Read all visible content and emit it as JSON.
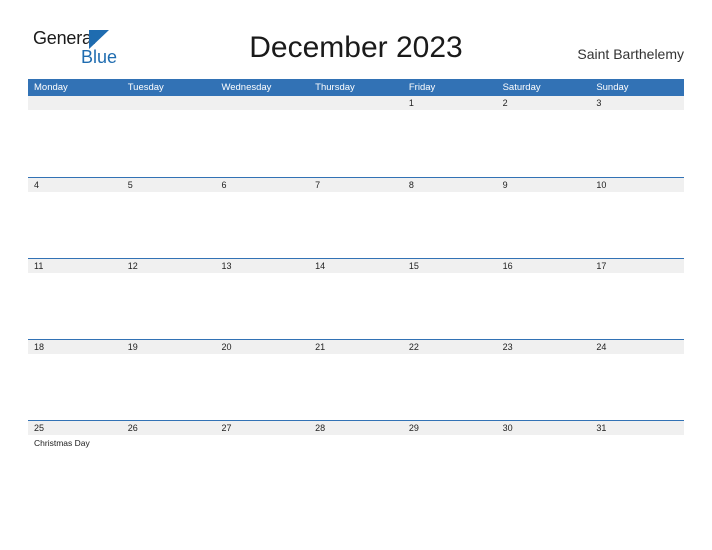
{
  "brand": {
    "name_part1": "General",
    "name_part2": "Blue",
    "triangle_icon": "blue-triangle-icon",
    "color_dark": "#1a1a1a",
    "color_blue": "#1f6cb0"
  },
  "header": {
    "title": "December 2023",
    "subtitle": "Saint Barthelemy"
  },
  "calendar": {
    "header_color": "#3272b5",
    "band_color": "#f0f0f0",
    "weekdays": [
      "Monday",
      "Tuesday",
      "Wednesday",
      "Thursday",
      "Friday",
      "Saturday",
      "Sunday"
    ],
    "weeks": [
      {
        "days": [
          {
            "num": "",
            "events": []
          },
          {
            "num": "",
            "events": []
          },
          {
            "num": "",
            "events": []
          },
          {
            "num": "",
            "events": []
          },
          {
            "num": "1",
            "events": []
          },
          {
            "num": "2",
            "events": []
          },
          {
            "num": "3",
            "events": []
          }
        ]
      },
      {
        "days": [
          {
            "num": "4",
            "events": []
          },
          {
            "num": "5",
            "events": []
          },
          {
            "num": "6",
            "events": []
          },
          {
            "num": "7",
            "events": []
          },
          {
            "num": "8",
            "events": []
          },
          {
            "num": "9",
            "events": []
          },
          {
            "num": "10",
            "events": []
          }
        ]
      },
      {
        "days": [
          {
            "num": "11",
            "events": []
          },
          {
            "num": "12",
            "events": []
          },
          {
            "num": "13",
            "events": []
          },
          {
            "num": "14",
            "events": []
          },
          {
            "num": "15",
            "events": []
          },
          {
            "num": "16",
            "events": []
          },
          {
            "num": "17",
            "events": []
          }
        ]
      },
      {
        "days": [
          {
            "num": "18",
            "events": []
          },
          {
            "num": "19",
            "events": []
          },
          {
            "num": "20",
            "events": []
          },
          {
            "num": "21",
            "events": []
          },
          {
            "num": "22",
            "events": []
          },
          {
            "num": "23",
            "events": []
          },
          {
            "num": "24",
            "events": []
          }
        ]
      },
      {
        "days": [
          {
            "num": "25",
            "events": [
              "Christmas Day"
            ]
          },
          {
            "num": "26",
            "events": []
          },
          {
            "num": "27",
            "events": []
          },
          {
            "num": "28",
            "events": []
          },
          {
            "num": "29",
            "events": []
          },
          {
            "num": "30",
            "events": []
          },
          {
            "num": "31",
            "events": []
          }
        ]
      }
    ]
  }
}
